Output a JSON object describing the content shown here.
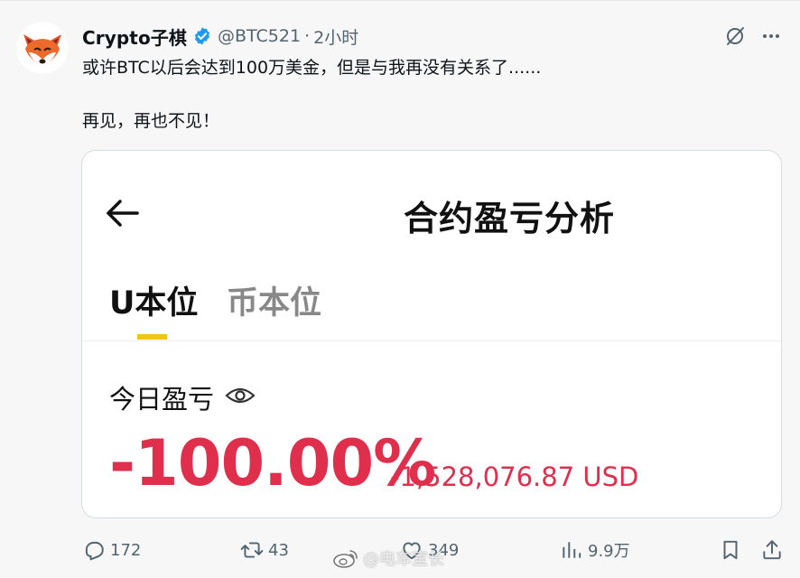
{
  "tweet": {
    "display_name": "Crypto子棋",
    "handle": "@BTC521",
    "separator": "·",
    "timestamp": "2小时",
    "text_line_1": "或许BTC以后会达到100万美金，但是与我再没有关系了......",
    "text_line_2": "再见，再也不见！",
    "icons": {
      "avatar": "fox-avatar",
      "verified": "verified-badge-icon",
      "grok": "grok-icon",
      "more": "more-icon"
    }
  },
  "media": {
    "screen_title": "合约盈亏分析",
    "tab_u": "U本位",
    "tab_coin": "币本位",
    "active_tab": "U本位",
    "pnl_label": "今日盈亏",
    "pnl_percent": "-100.00%",
    "pnl_amount": "-1,528,076.87 USD",
    "colors": {
      "loss": "#df2f4c",
      "tab_indicator": "#f0c419"
    }
  },
  "actions": {
    "reply_count": "172",
    "repost_count": "43",
    "like_count": "349",
    "views_count": "9.9万",
    "icons": [
      "reply-icon",
      "repost-icon",
      "like-icon",
      "views-icon",
      "bookmark-icon",
      "share-icon"
    ]
  },
  "watermark": {
    "text": "@电车室长"
  }
}
